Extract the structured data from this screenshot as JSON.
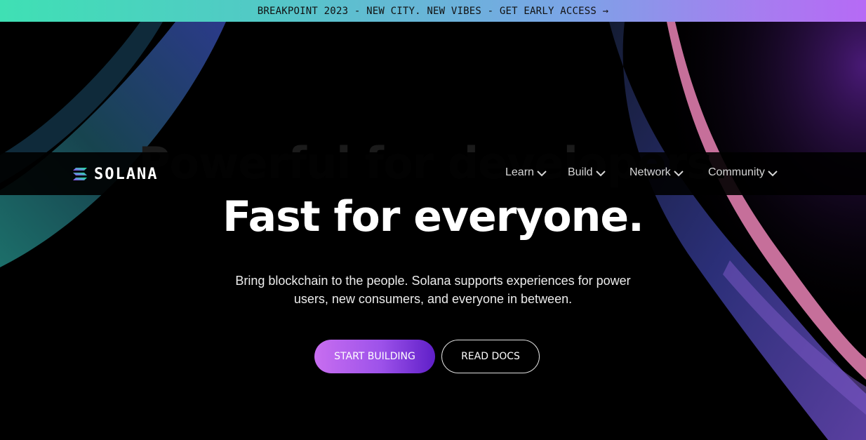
{
  "banner": {
    "text": "BREAKPOINT 2023 - NEW CITY. NEW VIBES - GET EARLY ACCESS →"
  },
  "nav": {
    "logo_text": "SOLANA",
    "items": [
      {
        "label": "Learn"
      },
      {
        "label": "Build"
      },
      {
        "label": "Network"
      },
      {
        "label": "Community"
      }
    ]
  },
  "hero": {
    "headline_back": "Powerful for developers.",
    "headline_front": "Fast for everyone.",
    "subtext": "Bring blockchain to the people. Solana supports experiences for power users, new consumers, and everyone in between.",
    "primary_cta": "START BUILDING",
    "secondary_cta": "READ DOCS"
  },
  "colors": {
    "banner_start": "#3fe0b4",
    "banner_end": "#b66af5",
    "primary_cta_start": "#c86ef0",
    "primary_cta_end": "#5f1fc8",
    "background": "#000000"
  }
}
